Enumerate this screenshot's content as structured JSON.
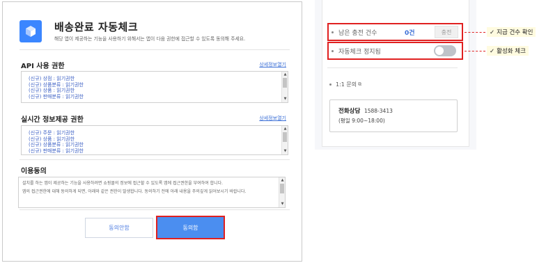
{
  "dialog": {
    "title": "배송완료 자동체크",
    "description": "해당 앱이 제공하는 기능을 사용하기 위해서는 앱이 다음 권한에 접근할 수 있도록 동의해 주세요.",
    "api_section": {
      "title": "API 사용 권한",
      "detail_link": "상세정보열기",
      "items": [
        "(신규) 상점 : 읽기권한",
        "(신규) 상품분류 : 읽기권한",
        "(신규) 상품 : 읽기권한",
        "(신규) 판매분류 : 읽기권한"
      ]
    },
    "realtime_section": {
      "title": "실시간 정보제공 권한",
      "detail_link": "상세정보열기",
      "items": [
        "(신규) 주문 : 읽기권한",
        "(신규) 상품 : 읽기권한",
        "(신규) 상품분류 : 읽기권한",
        "(신규) 판매분류 : 읽기권한"
      ]
    },
    "consent": {
      "title": "이용동의",
      "paragraphs": [
        "설치를 하는 앱이 제공하는 기능을 사용하려면 쇼핑몰의 정보에 접근할 수 있도록 앱에 접근권한을 부여하여 합니다.",
        "앱의 접근권한에 대해 동의하게 되면, 아래와 같은 권한이 발생합니다. 동의하기 전에 아래 내용을 주의깊게 읽어보시기 바랍니다."
      ]
    },
    "decline_label": "동의안함",
    "agree_label": "동의함"
  },
  "panel": {
    "remaining_label": "남은 충전 건수",
    "remaining_count": "0건",
    "charge_label": "충전",
    "auto_check_stop_label": "자동체크 정지됨",
    "toggle_on": false,
    "inquiry_label": "1:1 문의",
    "phone_title": "전화상담",
    "phone_number": "1588-3413",
    "phone_hours": "(평일 9:00~18:00)"
  },
  "annotations": {
    "remaining_callout": "지급 건수 확인",
    "toggle_callout": "활성화 체크",
    "check_glyph": "✓"
  },
  "colors": {
    "accent_blue": "#4b8ef0",
    "highlight_red": "#e02020",
    "link_blue": "#3b6fd6"
  }
}
